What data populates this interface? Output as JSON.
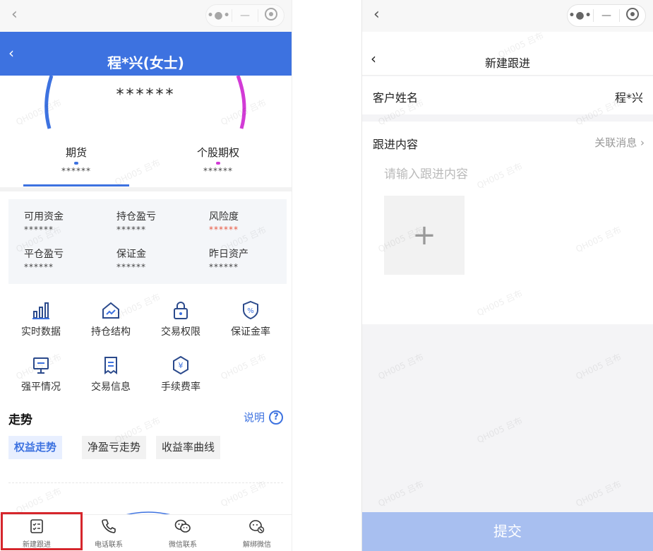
{
  "left": {
    "title": "程*兴(女士)",
    "gauge_value": "******",
    "tabs": [
      {
        "label": "期货",
        "value": "******",
        "color": "#3d72e0"
      },
      {
        "label": "个股期权",
        "value": "******",
        "color": "#d23bd6"
      }
    ],
    "stats": [
      {
        "label": "可用资金",
        "value": "******"
      },
      {
        "label": "持仓盈亏",
        "value": "******"
      },
      {
        "label": "风险度",
        "value": "******"
      },
      {
        "label": "平仓盈亏",
        "value": "******"
      },
      {
        "label": "保证金",
        "value": "******"
      },
      {
        "label": "昨日资产",
        "value": "******"
      }
    ],
    "grid": [
      {
        "label": "实时数据",
        "icon": "bar-chart-icon"
      },
      {
        "label": "持仓结构",
        "icon": "house-trend-icon"
      },
      {
        "label": "交易权限",
        "icon": "lock-icon"
      },
      {
        "label": "保证金率",
        "icon": "shield-percent-icon"
      },
      {
        "label": "强平情况",
        "icon": "monitor-icon"
      },
      {
        "label": "交易信息",
        "icon": "receipt-icon"
      },
      {
        "label": "手续费率",
        "icon": "yen-hexagon-icon"
      }
    ],
    "trend_title": "走势",
    "explain_label": "说明",
    "chips": [
      "权益走势",
      "净盈亏走势",
      "收益率曲线"
    ],
    "bottom_bar": [
      "新建跟进",
      "电话联系",
      "微信联系",
      "解绑微信"
    ]
  },
  "right": {
    "title": "新建跟进",
    "customer_label": "客户姓名",
    "customer_value": "程*兴",
    "content_label": "跟进内容",
    "related_link": "关联消息",
    "placeholder": "请输入跟进内容",
    "submit": "提交"
  },
  "watermark": "QH005 吕布",
  "colors": {
    "primary": "#3d72e0",
    "danger": "#e8563f",
    "submit_disabled": "#a8bff0"
  }
}
